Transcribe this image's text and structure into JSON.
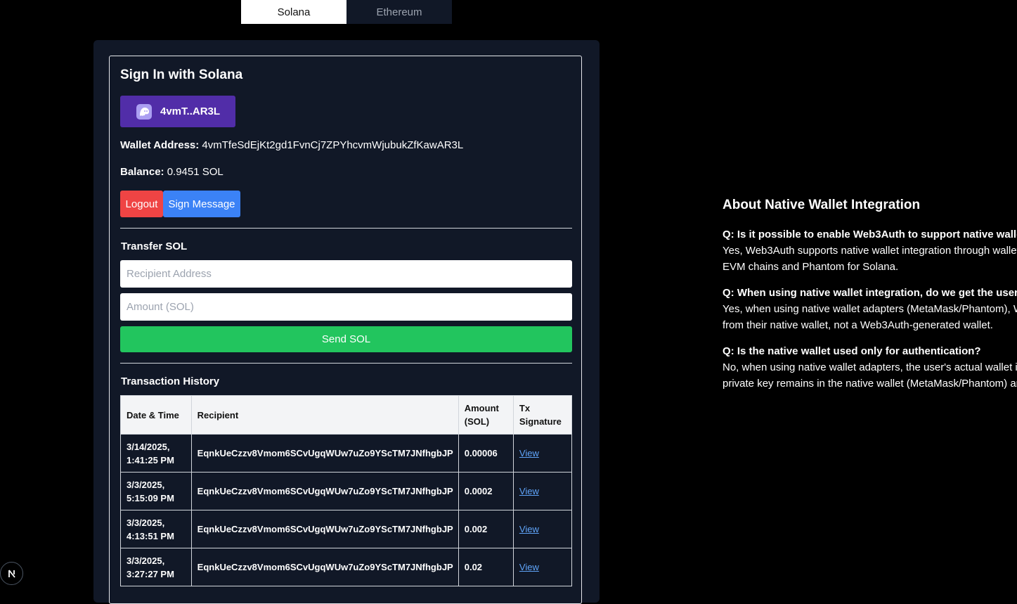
{
  "tabs": [
    {
      "label": "Solana",
      "active": true
    },
    {
      "label": "Ethereum",
      "active": false
    }
  ],
  "card": {
    "title": "Sign In with Solana",
    "wallet_button_label": "4vmT..AR3L",
    "wallet_icon": "phantom-ghost-icon",
    "wallet_address_label": "Wallet Address:",
    "wallet_address_value": "4vmTfeSdEjKt2gd1FvnCj7ZPYhcvmWjubukZfKawAR3L",
    "balance_label": "Balance:",
    "balance_value": "0.9451 SOL",
    "logout_label": "Logout",
    "sign_message_label": "Sign Message"
  },
  "transfer": {
    "title": "Transfer SOL",
    "recipient_placeholder": "Recipient Address",
    "amount_placeholder": "Amount (SOL)",
    "send_label": "Send SOL"
  },
  "history": {
    "title": "Transaction History",
    "columns": [
      "Date & Time",
      "Recipient",
      "Amount (SOL)",
      "Tx Signature"
    ],
    "rows": [
      {
        "date": "3/14/2025, 1:41:25 PM",
        "recipient": "EqnkUeCzzv8Vmom6SCvUgqWUw7uZo9YScTM7JNfhgbJP",
        "amount": "0.00006",
        "link": "View"
      },
      {
        "date": "3/3/2025, 5:15:09 PM",
        "recipient": "EqnkUeCzzv8Vmom6SCvUgqWUw7uZo9YScTM7JNfhgbJP",
        "amount": "0.0002",
        "link": "View"
      },
      {
        "date": "3/3/2025, 4:13:51 PM",
        "recipient": "EqnkUeCzzv8Vmom6SCvUgqWUw7uZo9YScTM7JNfhgbJP",
        "amount": "0.002",
        "link": "View"
      },
      {
        "date": "3/3/2025, 3:27:27 PM",
        "recipient": "EqnkUeCzzv8Vmom6SCvUgqWUw7uZo9YScTM7JNfhgbJP",
        "amount": "0.02",
        "link": "View"
      }
    ]
  },
  "about": {
    "title": "About Native Wallet Integration",
    "faqs": [
      {
        "q": "Q: Is it possible to enable Web3Auth to support native walle",
        "a1": "Yes, Web3Auth supports native wallet integration through wallet",
        "a2": "EVM chains and Phantom for Solana."
      },
      {
        "q": "Q: When using native wallet integration, do we get the user",
        "a1": "Yes, when using native wallet adapters (MetaMask/Phantom), W",
        "a2": "from their native wallet, not a Web3Auth-generated wallet."
      },
      {
        "q": "Q: Is the native wallet used only for authentication?",
        "a1": "No, when using native wallet adapters, the user's actual wallet i",
        "a2": "private key remains in the native wallet (MetaMask/Phantom) ar"
      }
    ]
  },
  "badge": {
    "letter": "N"
  },
  "colors": {
    "background": "#000000",
    "panel": "#111827",
    "wallet_button": "#512da8",
    "logout": "#ef4444",
    "sign_message": "#3b82f6",
    "send": "#22c55e",
    "link": "#60a5fa"
  }
}
